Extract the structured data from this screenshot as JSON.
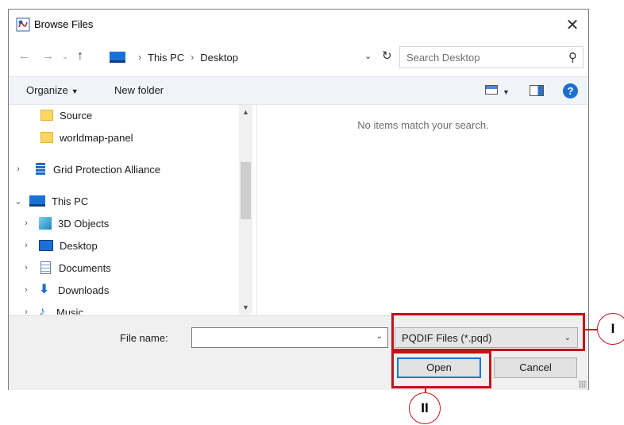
{
  "dialog": {
    "title": "Browse Files",
    "close_glyph": "✕"
  },
  "nav": {
    "back_glyph": "←",
    "forward_glyph": "→",
    "recent_glyph": "⌄",
    "up_glyph": "↑",
    "breadcrumbs": [
      "This PC",
      "Desktop"
    ],
    "crumb_separator": "›",
    "dropdown_glyph": "⌄",
    "refresh_glyph": "↻"
  },
  "search": {
    "placeholder": "Search Desktop",
    "icon_glyph": "⚲"
  },
  "toolbar": {
    "organize_label": "Organize",
    "new_folder_label": "New folder",
    "help_label": "?"
  },
  "tree": {
    "items": [
      {
        "label": "Source",
        "icon": "folder-icon"
      },
      {
        "label": "worldmap-panel",
        "icon": "folder-icon"
      },
      {
        "label": "Grid Protection Alliance",
        "icon": "building-icon",
        "expander": "›"
      },
      {
        "label": "This PC",
        "icon": "computer-icon",
        "expander": "⌄"
      },
      {
        "label": "3D Objects",
        "icon": "3d-objects-icon",
        "expander": "›"
      },
      {
        "label": "Desktop",
        "icon": "desktop-icon",
        "expander": "›"
      },
      {
        "label": "Documents",
        "icon": "documents-icon",
        "expander": "›"
      },
      {
        "label": "Downloads",
        "icon": "downloads-icon",
        "expander": "›"
      },
      {
        "label": "Music",
        "icon": "music-icon",
        "expander": "›"
      }
    ]
  },
  "content": {
    "empty_message": "No items match your search."
  },
  "footer": {
    "file_name_label": "File name:",
    "file_name_value": "",
    "file_type_value": "PQDIF Files (*.pqd)",
    "open_label": "Open",
    "cancel_label": "Cancel"
  },
  "callouts": {
    "first": "I",
    "second": "II"
  },
  "colors": {
    "accent": "#0078d7",
    "highlight": "#c0141c",
    "toolbar_bg": "#f0f4f9"
  }
}
